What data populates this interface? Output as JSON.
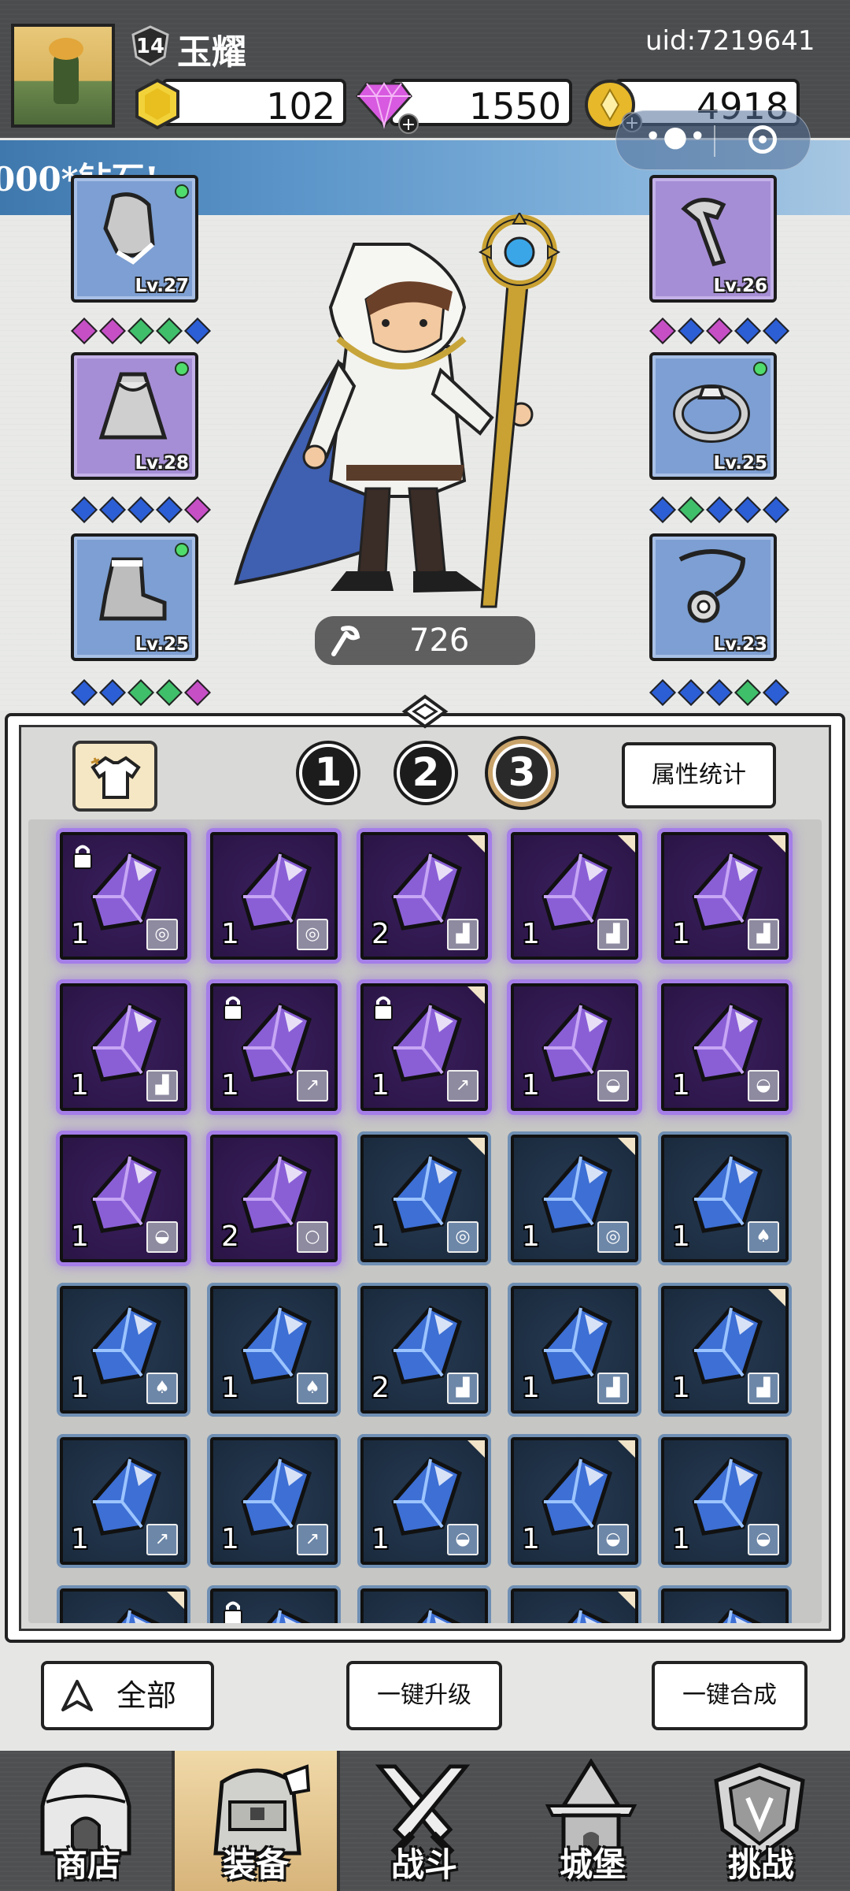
{
  "player": {
    "level": "14",
    "name": "玉耀",
    "uid": "uid:7219641"
  },
  "resources": {
    "gold": "102",
    "diamond": "1550",
    "coin": "4918"
  },
  "marquee": "000*钻石!",
  "hero": {
    "power": "726"
  },
  "equipment": {
    "left": [
      {
        "name": "helmet",
        "level": "Lv.27",
        "color": "blue",
        "dot": true,
        "gems": [
          "p",
          "p",
          "g",
          "g",
          "b"
        ]
      },
      {
        "name": "cloak",
        "level": "Lv.28",
        "color": "purple",
        "dot": true,
        "gems": [
          "b",
          "b",
          "b",
          "b",
          "p"
        ]
      },
      {
        "name": "boots",
        "level": "Lv.25",
        "color": "blue",
        "dot": true,
        "gems": [
          "b",
          "b",
          "g",
          "g",
          "p"
        ]
      }
    ],
    "right": [
      {
        "name": "weapon",
        "level": "Lv.26",
        "color": "purple",
        "dot": false,
        "gems": [
          "p",
          "b",
          "p",
          "b",
          "b"
        ]
      },
      {
        "name": "ring",
        "level": "Lv.25",
        "color": "blue",
        "dot": true,
        "gems": [
          "b",
          "g",
          "b",
          "b",
          "b"
        ]
      },
      {
        "name": "necklace",
        "level": "Lv.23",
        "color": "blue",
        "dot": false,
        "gems": [
          "b",
          "b",
          "b",
          "g",
          "b"
        ]
      }
    ]
  },
  "tabs": [
    "1",
    "2",
    "3"
  ],
  "active_tab": "3",
  "stats_button": "属性统计",
  "inventory": [
    [
      {
        "color": "purple",
        "count": "1",
        "lock": true,
        "corner": false,
        "tag": "ring"
      },
      {
        "color": "purple",
        "count": "1",
        "lock": false,
        "corner": false,
        "tag": "ring"
      },
      {
        "color": "purple",
        "count": "2",
        "lock": false,
        "corner": true,
        "tag": "boot"
      },
      {
        "color": "purple",
        "count": "1",
        "lock": false,
        "corner": true,
        "tag": "boot"
      },
      {
        "color": "purple",
        "count": "1",
        "lock": false,
        "corner": true,
        "tag": "boot"
      }
    ],
    [
      {
        "color": "purple",
        "count": "1",
        "lock": false,
        "corner": false,
        "tag": "boot"
      },
      {
        "color": "purple",
        "count": "1",
        "lock": true,
        "corner": false,
        "tag": "staff"
      },
      {
        "color": "purple",
        "count": "1",
        "lock": true,
        "corner": true,
        "tag": "staff"
      },
      {
        "color": "purple",
        "count": "1",
        "lock": false,
        "corner": false,
        "tag": "hat"
      },
      {
        "color": "purple",
        "count": "1",
        "lock": false,
        "corner": false,
        "tag": "hat"
      }
    ],
    [
      {
        "color": "purple",
        "count": "1",
        "lock": false,
        "corner": false,
        "tag": "hat"
      },
      {
        "color": "purple",
        "count": "2",
        "lock": false,
        "corner": false,
        "tag": "necklace"
      },
      {
        "color": "blue",
        "count": "1",
        "lock": false,
        "corner": true,
        "tag": "ring"
      },
      {
        "color": "blue",
        "count": "1",
        "lock": false,
        "corner": true,
        "tag": "ring"
      },
      {
        "color": "blue",
        "count": "1",
        "lock": false,
        "corner": false,
        "tag": "cloak"
      }
    ],
    [
      {
        "color": "blue",
        "count": "1",
        "lock": false,
        "corner": false,
        "tag": "cloak"
      },
      {
        "color": "blue",
        "count": "1",
        "lock": false,
        "corner": false,
        "tag": "cloak"
      },
      {
        "color": "blue",
        "count": "2",
        "lock": false,
        "corner": false,
        "tag": "boot"
      },
      {
        "color": "blue",
        "count": "1",
        "lock": false,
        "corner": false,
        "tag": "boot"
      },
      {
        "color": "blue",
        "count": "1",
        "lock": false,
        "corner": true,
        "tag": "boot"
      }
    ],
    [
      {
        "color": "blue",
        "count": "1",
        "lock": false,
        "corner": false,
        "tag": "staff"
      },
      {
        "color": "blue",
        "count": "1",
        "lock": false,
        "corner": false,
        "tag": "staff"
      },
      {
        "color": "blue",
        "count": "1",
        "lock": false,
        "corner": true,
        "tag": "hat"
      },
      {
        "color": "blue",
        "count": "1",
        "lock": false,
        "corner": true,
        "tag": "hat"
      },
      {
        "color": "blue",
        "count": "1",
        "lock": false,
        "corner": false,
        "tag": "hat"
      }
    ],
    [
      {
        "color": "blue",
        "count": "",
        "lock": false,
        "corner": true,
        "tag": ""
      },
      {
        "color": "blue",
        "count": "",
        "lock": true,
        "corner": false,
        "tag": ""
      },
      {
        "color": "blue",
        "count": "",
        "lock": false,
        "corner": false,
        "tag": ""
      },
      {
        "color": "blue",
        "count": "",
        "lock": false,
        "corner": true,
        "tag": ""
      },
      {
        "color": "blue",
        "count": "",
        "lock": false,
        "corner": false,
        "tag": ""
      }
    ]
  ],
  "actions": {
    "all": "全部",
    "upgrade": "一键升级",
    "merge": "一键合成"
  },
  "nav": [
    {
      "label": "商店",
      "icon": "shop-icon",
      "active": false
    },
    {
      "label": "装备",
      "icon": "backpack-icon",
      "active": true
    },
    {
      "label": "战斗",
      "icon": "swords-icon",
      "active": false
    },
    {
      "label": "城堡",
      "icon": "castle-icon",
      "active": false
    },
    {
      "label": "挑战",
      "icon": "shield-icon",
      "active": false
    }
  ],
  "colors": {
    "accent_purple": "#a57ee8",
    "accent_blue": "#6f8fb4",
    "nav_active": "#e6c993",
    "topbar": "#4a4c4e"
  }
}
